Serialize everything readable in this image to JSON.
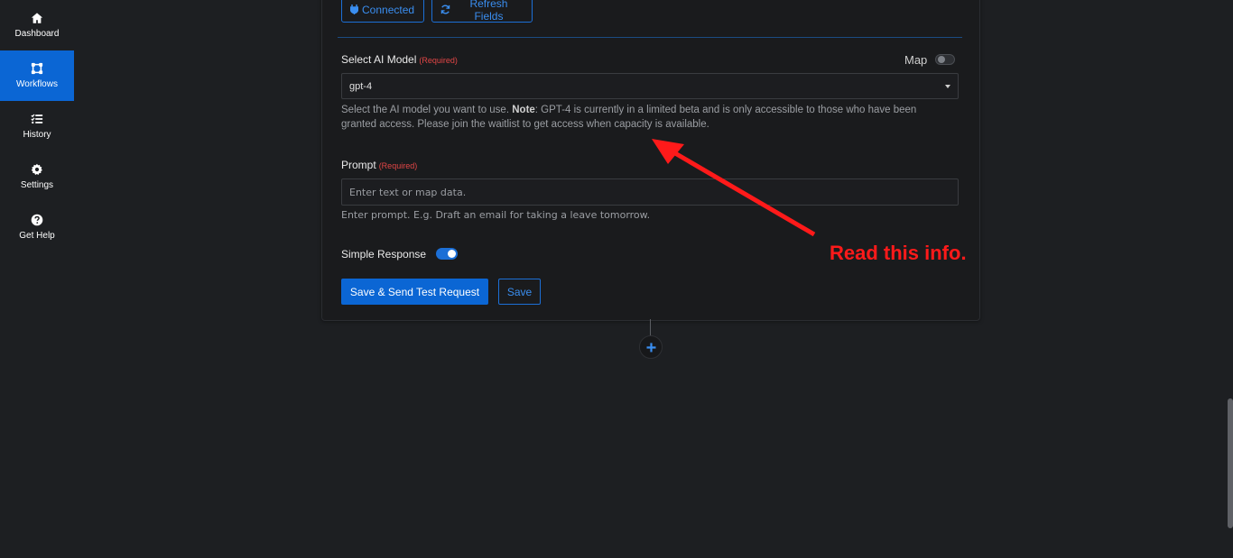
{
  "sidebar": {
    "items": [
      {
        "label": "Dashboard",
        "icon": "home-icon"
      },
      {
        "label": "Workflows",
        "icon": "workflow-icon",
        "active": true
      },
      {
        "label": "History",
        "icon": "list-check-icon"
      },
      {
        "label": "Settings",
        "icon": "gear-icon"
      },
      {
        "label": "Get Help",
        "icon": "question-circle-icon"
      }
    ]
  },
  "connection": {
    "connected_label": "Connected",
    "refresh_label": "Refresh Fields"
  },
  "model": {
    "label": "Select AI Model",
    "required": "(Required)",
    "map_label": "Map",
    "map_enabled": false,
    "selected": "gpt-4",
    "help_prefix": "Select the AI model you want to use. ",
    "help_note": "Note",
    "help_line1_rest": ": GPT-4 is currently in a limited beta and is only accessible to those who have been",
    "help_line2": "granted access. Please join the waitlist to get access when capacity is available."
  },
  "prompt": {
    "label": "Prompt",
    "required": "(Required)",
    "placeholder": "Enter text or map data.",
    "help": "Enter prompt. E.g. Draft an email for taking a leave tomorrow."
  },
  "simple_response": {
    "label": "Simple Response",
    "enabled": true
  },
  "actions": {
    "save_test_label": "Save & Send Test Request",
    "save_label": "Save"
  },
  "annotation": {
    "text": "Read this info.",
    "color": "#ff1a1a"
  },
  "colors": {
    "accent": "#0b66d4",
    "required": "#e24646",
    "background": "#1d1f22"
  }
}
